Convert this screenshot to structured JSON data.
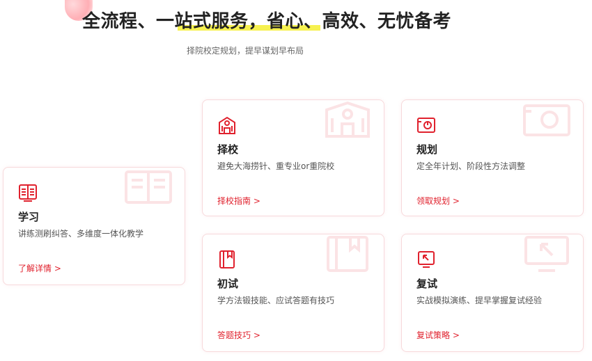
{
  "header": {
    "title": "全流程、一站式服务，省心、高效、无忧备考",
    "subtitle": "择院校定规划，提早谋划早布局"
  },
  "colors": {
    "accent": "#e0212d",
    "highlight": "#f5ef3d",
    "card_border": "#f7d9db"
  },
  "cards": {
    "study": {
      "icon": "open-book-icon",
      "title": "学习",
      "desc": "讲练测刷纠答、多维度一体化教学",
      "link": "了解详情 >"
    },
    "school": {
      "icon": "school-building-icon",
      "title": "择校",
      "desc": "避免大海捞针、重专业or重院校",
      "link": "择校指南 >"
    },
    "plan": {
      "icon": "planning-chart-icon",
      "title": "规划",
      "desc": "定全年计划、阶段性方法调整",
      "link": "领取规划 >"
    },
    "exam": {
      "icon": "bookmark-book-icon",
      "title": "初试",
      "desc": "学方法锻技能、应试答题有技巧",
      "link": "答题技巧 >"
    },
    "retest": {
      "icon": "monitor-arrow-icon",
      "title": "复试",
      "desc": "实战模拟演练、提早掌握复试经验",
      "link": "复试策略 >"
    }
  }
}
